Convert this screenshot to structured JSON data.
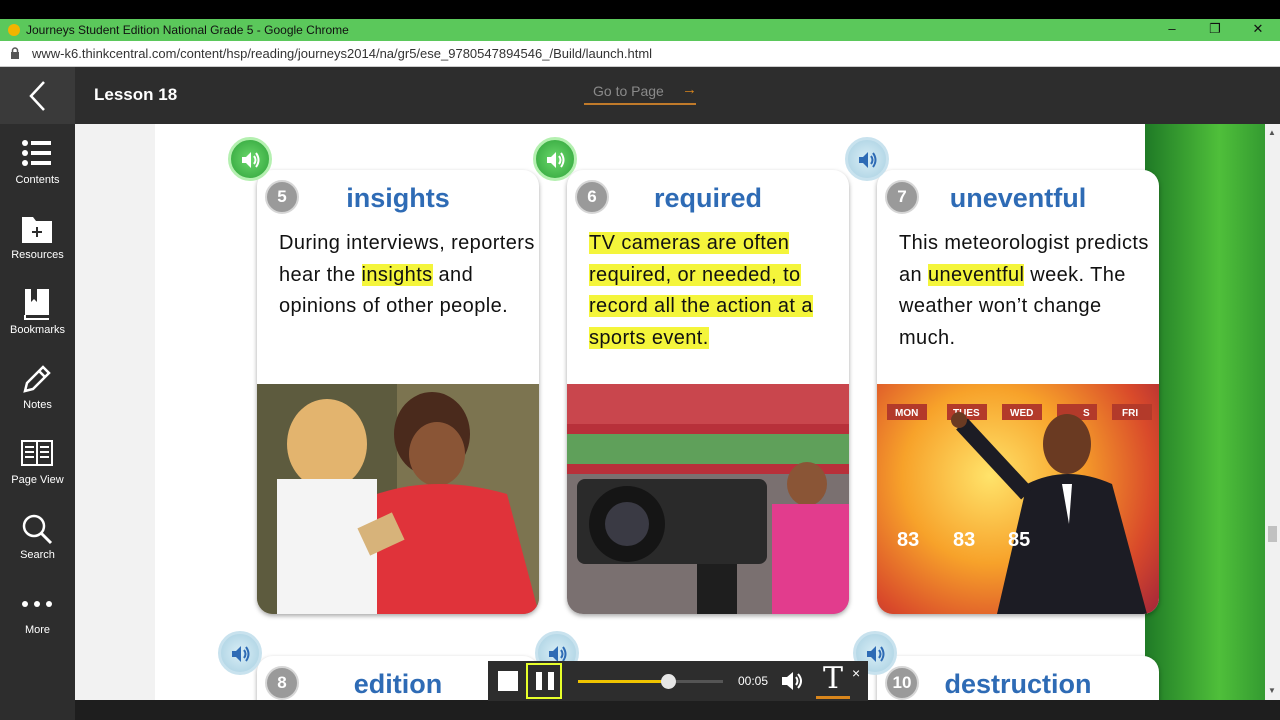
{
  "browser": {
    "tab_title": "Journeys Student Edition National Grade 5 - Google Chrome",
    "url": "www-k6.thinkcentral.com/content/hsp/reading/journeys2014/na/gr5/ese_9780547894546_/Build/launch.html",
    "minimize": "–",
    "restore": "❐",
    "close": "✕"
  },
  "header": {
    "lesson": "Lesson 18",
    "goto_label": "Go to Page",
    "goto_arrow": "→"
  },
  "sidebar": {
    "items": [
      {
        "label": "Contents",
        "icon": "list-icon"
      },
      {
        "label": "Resources",
        "icon": "folder-plus-icon"
      },
      {
        "label": "Bookmarks",
        "icon": "bookmark-book-icon"
      },
      {
        "label": "Notes",
        "icon": "pencil-icon"
      },
      {
        "label": "Page View",
        "icon": "page-view-icon"
      },
      {
        "label": "Search",
        "icon": "search-icon"
      },
      {
        "label": "More",
        "icon": "more-dots-icon"
      }
    ]
  },
  "cards": [
    {
      "num": "5",
      "word": "insights",
      "sentence_parts": [
        "During interviews, reporters hear the ",
        "insights",
        " and opinions of other people."
      ]
    },
    {
      "num": "6",
      "word": "required",
      "sentence_parts": [
        "",
        "TV cameras are often required, or needed, to record all the action at a sports event.",
        ""
      ]
    },
    {
      "num": "7",
      "word": "uneventful",
      "sentence_parts": [
        "This meteorologist predicts an ",
        "uneventful",
        " week. The weather won’t change much."
      ]
    },
    {
      "num": "8",
      "word": "edition"
    },
    {
      "num": "10",
      "word": "destruction"
    }
  ],
  "weather": {
    "days": [
      "MON",
      "TUES",
      "WED",
      "S",
      "FRI"
    ],
    "temps": [
      "83",
      "83",
      "85"
    ]
  },
  "player": {
    "time": "00:05",
    "progress": 0.62,
    "text_toggle": "T",
    "close": "×"
  },
  "colors": {
    "word": "#2e6bb5",
    "highlight": "#f4f53b",
    "audio_active": "#2ea23a",
    "accent": "#d9861c"
  }
}
